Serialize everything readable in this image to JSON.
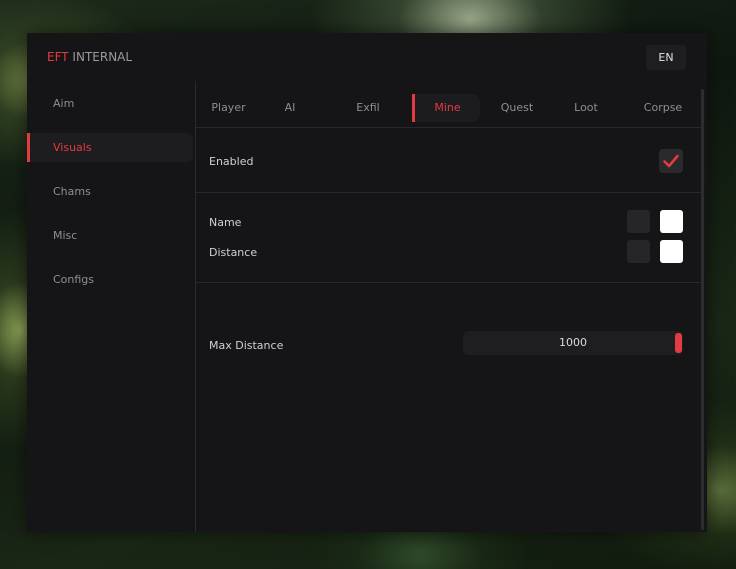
{
  "window": {
    "brand_accent": "EFT",
    "brand_rest": " INTERNAL",
    "lang_button": "EN"
  },
  "sidebar": {
    "items": [
      {
        "label": "Aim"
      },
      {
        "label": "Visuals",
        "active": true
      },
      {
        "label": "Chams"
      },
      {
        "label": "Misc"
      },
      {
        "label": "Configs"
      }
    ]
  },
  "tabs": [
    {
      "label": "Player"
    },
    {
      "label": "AI"
    },
    {
      "label": "Exfil"
    },
    {
      "label": "Mine",
      "active": true
    },
    {
      "label": "Quest"
    },
    {
      "label": "Loot"
    },
    {
      "label": "Corpse"
    }
  ],
  "settings": {
    "enabled": {
      "label": "Enabled",
      "checked": true
    },
    "name": {
      "label": "Name",
      "color_primary": "#262629",
      "color_secondary": "#ffffff"
    },
    "distance": {
      "label": "Distance",
      "color_primary": "#262629",
      "color_secondary": "#ffffff"
    },
    "max_distance": {
      "label": "Max Distance",
      "value": "1000",
      "fraction": 1.0
    }
  },
  "colors": {
    "accent": "#e23b42",
    "background": "#151517",
    "text_muted": "#8e8e92"
  }
}
